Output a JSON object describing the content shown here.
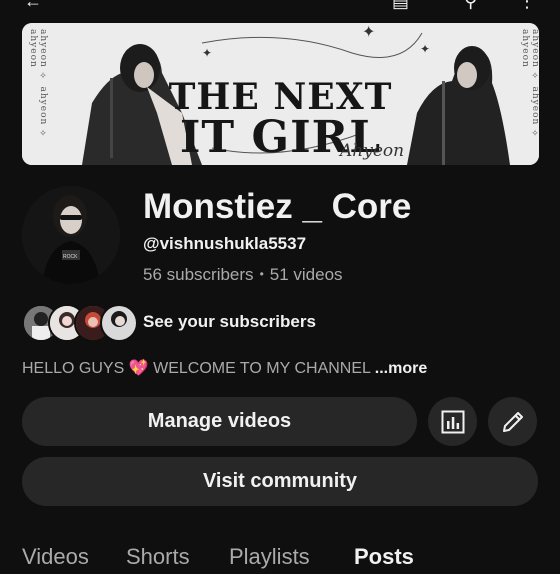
{
  "icons": {
    "back": "arrow-left-icon",
    "cast": "cast-icon",
    "search": "search-icon",
    "more": "more-vert-icon",
    "analytics": "analytics-icon",
    "edit": "pencil-icon"
  },
  "banner": {
    "line1": "THE NEXT",
    "line2": "IT GIRL",
    "signature": "Ahyeon",
    "side_text": "ahyeon ✧ ahyeon ✧ ahyeon"
  },
  "channel": {
    "name": "Monstiez _ Core",
    "handle": "@vishnushukla5537",
    "subscribers": "56 subscribers",
    "separator": "•",
    "videos": "51 videos",
    "see_subscribers": "See your subscribers",
    "description": "HELLO GUYS",
    "description_emoji": "💖",
    "description_rest": "WELCOME TO MY CHANNEL",
    "more_label": "...more"
  },
  "buttons": {
    "manage_videos": "Manage videos",
    "visit_community": "Visit community"
  },
  "tabs": [
    {
      "label": "Videos"
    },
    {
      "label": "Shorts"
    },
    {
      "label": "Playlists"
    },
    {
      "label": "Posts"
    }
  ],
  "colors": {
    "background": "#0f0f0f",
    "button": "#272727",
    "text_primary": "#f1f1f1",
    "text_secondary": "#aaaaaa"
  }
}
